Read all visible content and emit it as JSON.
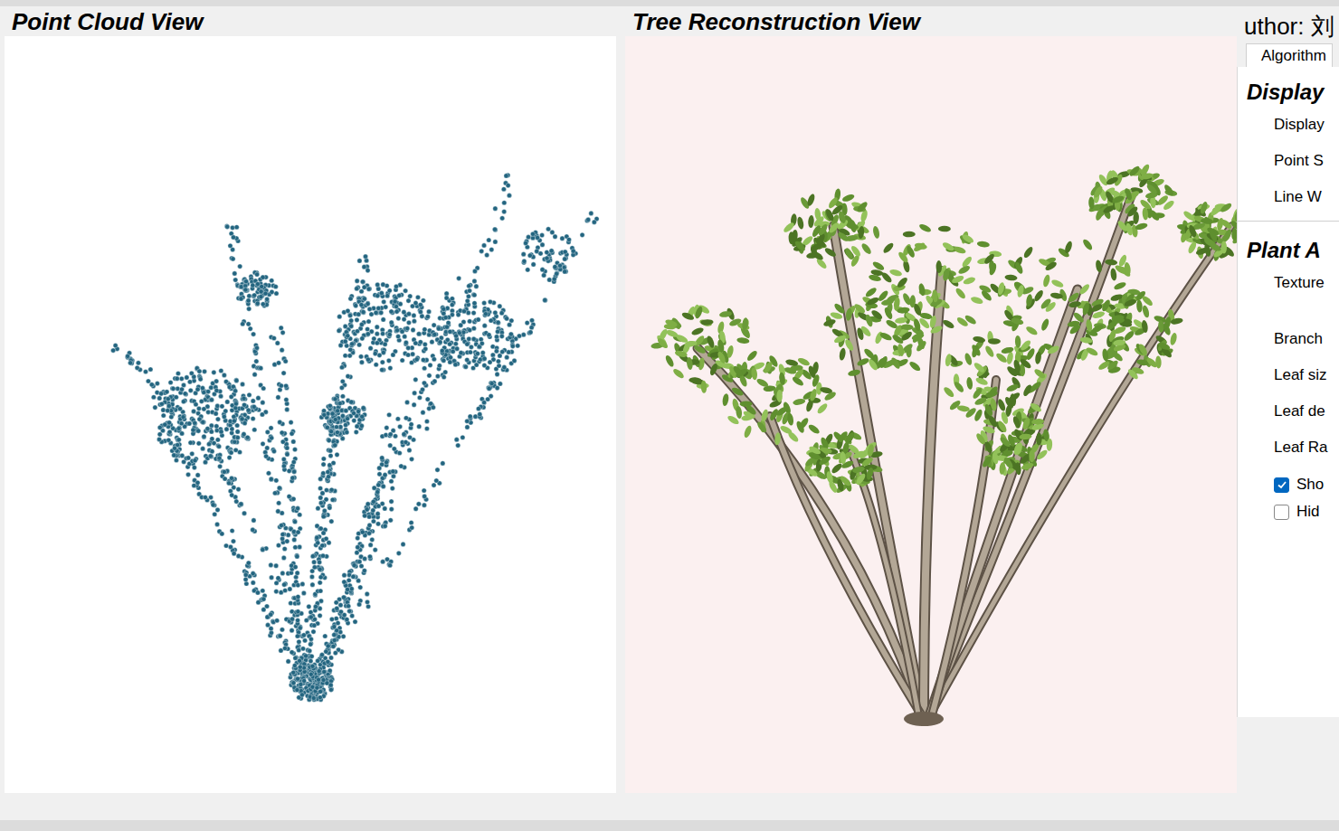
{
  "views": [
    {
      "title": "Point Cloud View",
      "kind": "cloud"
    },
    {
      "title": "Tree Reconstruction View",
      "kind": "tree"
    }
  ],
  "side_panel": {
    "author": "uthor: 刘",
    "tabs": [
      {
        "label": "Algorithm",
        "selected": true
      }
    ],
    "sections": [
      {
        "title": "Display",
        "items": [
          {
            "kind": "label",
            "label": "Display"
          },
          {
            "kind": "label",
            "label": "Point S"
          },
          {
            "kind": "label",
            "label": "Line W"
          }
        ]
      },
      {
        "title": "Plant A",
        "items": [
          {
            "kind": "tall",
            "label": "Texture"
          },
          {
            "kind": "label",
            "label": "Branch"
          },
          {
            "kind": "label",
            "label": "Leaf siz"
          },
          {
            "kind": "label",
            "label": "Leaf de"
          },
          {
            "kind": "label",
            "label": "Leaf Ra"
          },
          {
            "kind": "checkbox",
            "label": "Sho",
            "checked": true
          },
          {
            "kind": "checkbox",
            "label": "Hid",
            "checked": false
          }
        ]
      }
    ]
  }
}
